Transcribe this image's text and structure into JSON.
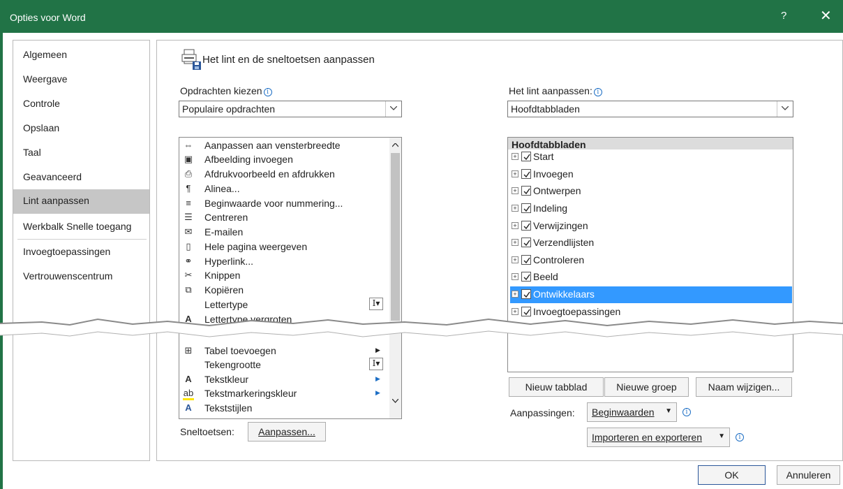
{
  "window": {
    "title": "Opties voor Word",
    "help": "?",
    "close": "✕"
  },
  "nav": {
    "items": [
      {
        "label": "Algemeen"
      },
      {
        "label": "Weergave"
      },
      {
        "label": "Controle"
      },
      {
        "label": "Opslaan"
      },
      {
        "label": "Taal"
      },
      {
        "label": "Geavanceerd"
      },
      {
        "label": "Lint aanpassen",
        "selected": true
      },
      {
        "label": "Werkbalk Snelle toegang"
      },
      {
        "label": "Invoegtoepassingen"
      },
      {
        "label": "Vertrouwenscentrum"
      }
    ]
  },
  "heading": "Het lint en de sneltoetsen aanpassen",
  "left": {
    "label": "Opdrachten kiezen",
    "combo_value": "Populaire opdrachten",
    "commands_top": [
      {
        "label": "Aanpassen aan vensterbreedte",
        "icon": "fit-width-icon"
      },
      {
        "label": "Afbeelding invoegen",
        "icon": "insert-picture-icon"
      },
      {
        "label": "Afdrukvoorbeeld en afdrukken",
        "icon": "print-preview-icon"
      },
      {
        "label": "Alinea...",
        "icon": "paragraph-icon"
      },
      {
        "label": "Beginwaarde voor nummering...",
        "icon": "numbering-icon"
      },
      {
        "label": "Centreren",
        "icon": "center-icon"
      },
      {
        "label": "E-mailen",
        "icon": "email-icon"
      },
      {
        "label": "Hele pagina weergeven",
        "icon": "page-icon"
      },
      {
        "label": "Hyperlink...",
        "icon": "hyperlink-icon"
      },
      {
        "label": "Knippen",
        "icon": "scissors-icon"
      },
      {
        "label": "Kopiëren",
        "icon": "copy-icon"
      },
      {
        "label": "Lettertype",
        "icon": ""
      },
      {
        "label": "Lettertype vergroten",
        "icon": "grow-font-icon"
      }
    ],
    "commands_bottom": [
      {
        "label": "Tabel toevoegen",
        "icon": "table-icon"
      },
      {
        "label": "Tekengrootte",
        "icon": ""
      },
      {
        "label": "Tekstkleur",
        "icon": "font-color-icon"
      },
      {
        "label": "Tekstmarkeringskleur",
        "icon": "highlight-icon"
      },
      {
        "label": "Tekststijlen",
        "icon": "styles-icon"
      }
    ],
    "shortcut_label": "Sneltoetsen:",
    "shortcut_button": "Aanpassen..."
  },
  "right": {
    "label": "Het lint aanpassen:",
    "combo_value": "Hoofdtabbladen",
    "tree_header": "Hoofdtabbladen",
    "tabs": [
      {
        "label": "Start",
        "checked": true
      },
      {
        "label": "Invoegen",
        "checked": true
      },
      {
        "label": "Ontwerpen",
        "checked": true
      },
      {
        "label": "Indeling",
        "checked": true
      },
      {
        "label": "Verwijzingen",
        "checked": true
      },
      {
        "label": "Verzendlijsten",
        "checked": true
      },
      {
        "label": "Controleren",
        "checked": true
      },
      {
        "label": "Beeld",
        "checked": true
      },
      {
        "label": "Ontwikkelaars",
        "checked": true,
        "selected": true
      },
      {
        "label": "Invoegtoepassingen",
        "checked": true
      }
    ],
    "buttons": {
      "new_tab": "Nieuw tabblad",
      "new_group": "Nieuwe groep",
      "rename": "Naam wijzigen..."
    },
    "customizations_label": "Aanpassingen:",
    "reset_button": "Beginwaarden",
    "import_export_button": "Importeren en exporteren"
  },
  "footer": {
    "ok": "OK",
    "cancel": "Annuleren"
  },
  "colors": {
    "titlebar": "#217346",
    "selection": "#3399ff",
    "nav_selected": "#c6c6c6"
  }
}
